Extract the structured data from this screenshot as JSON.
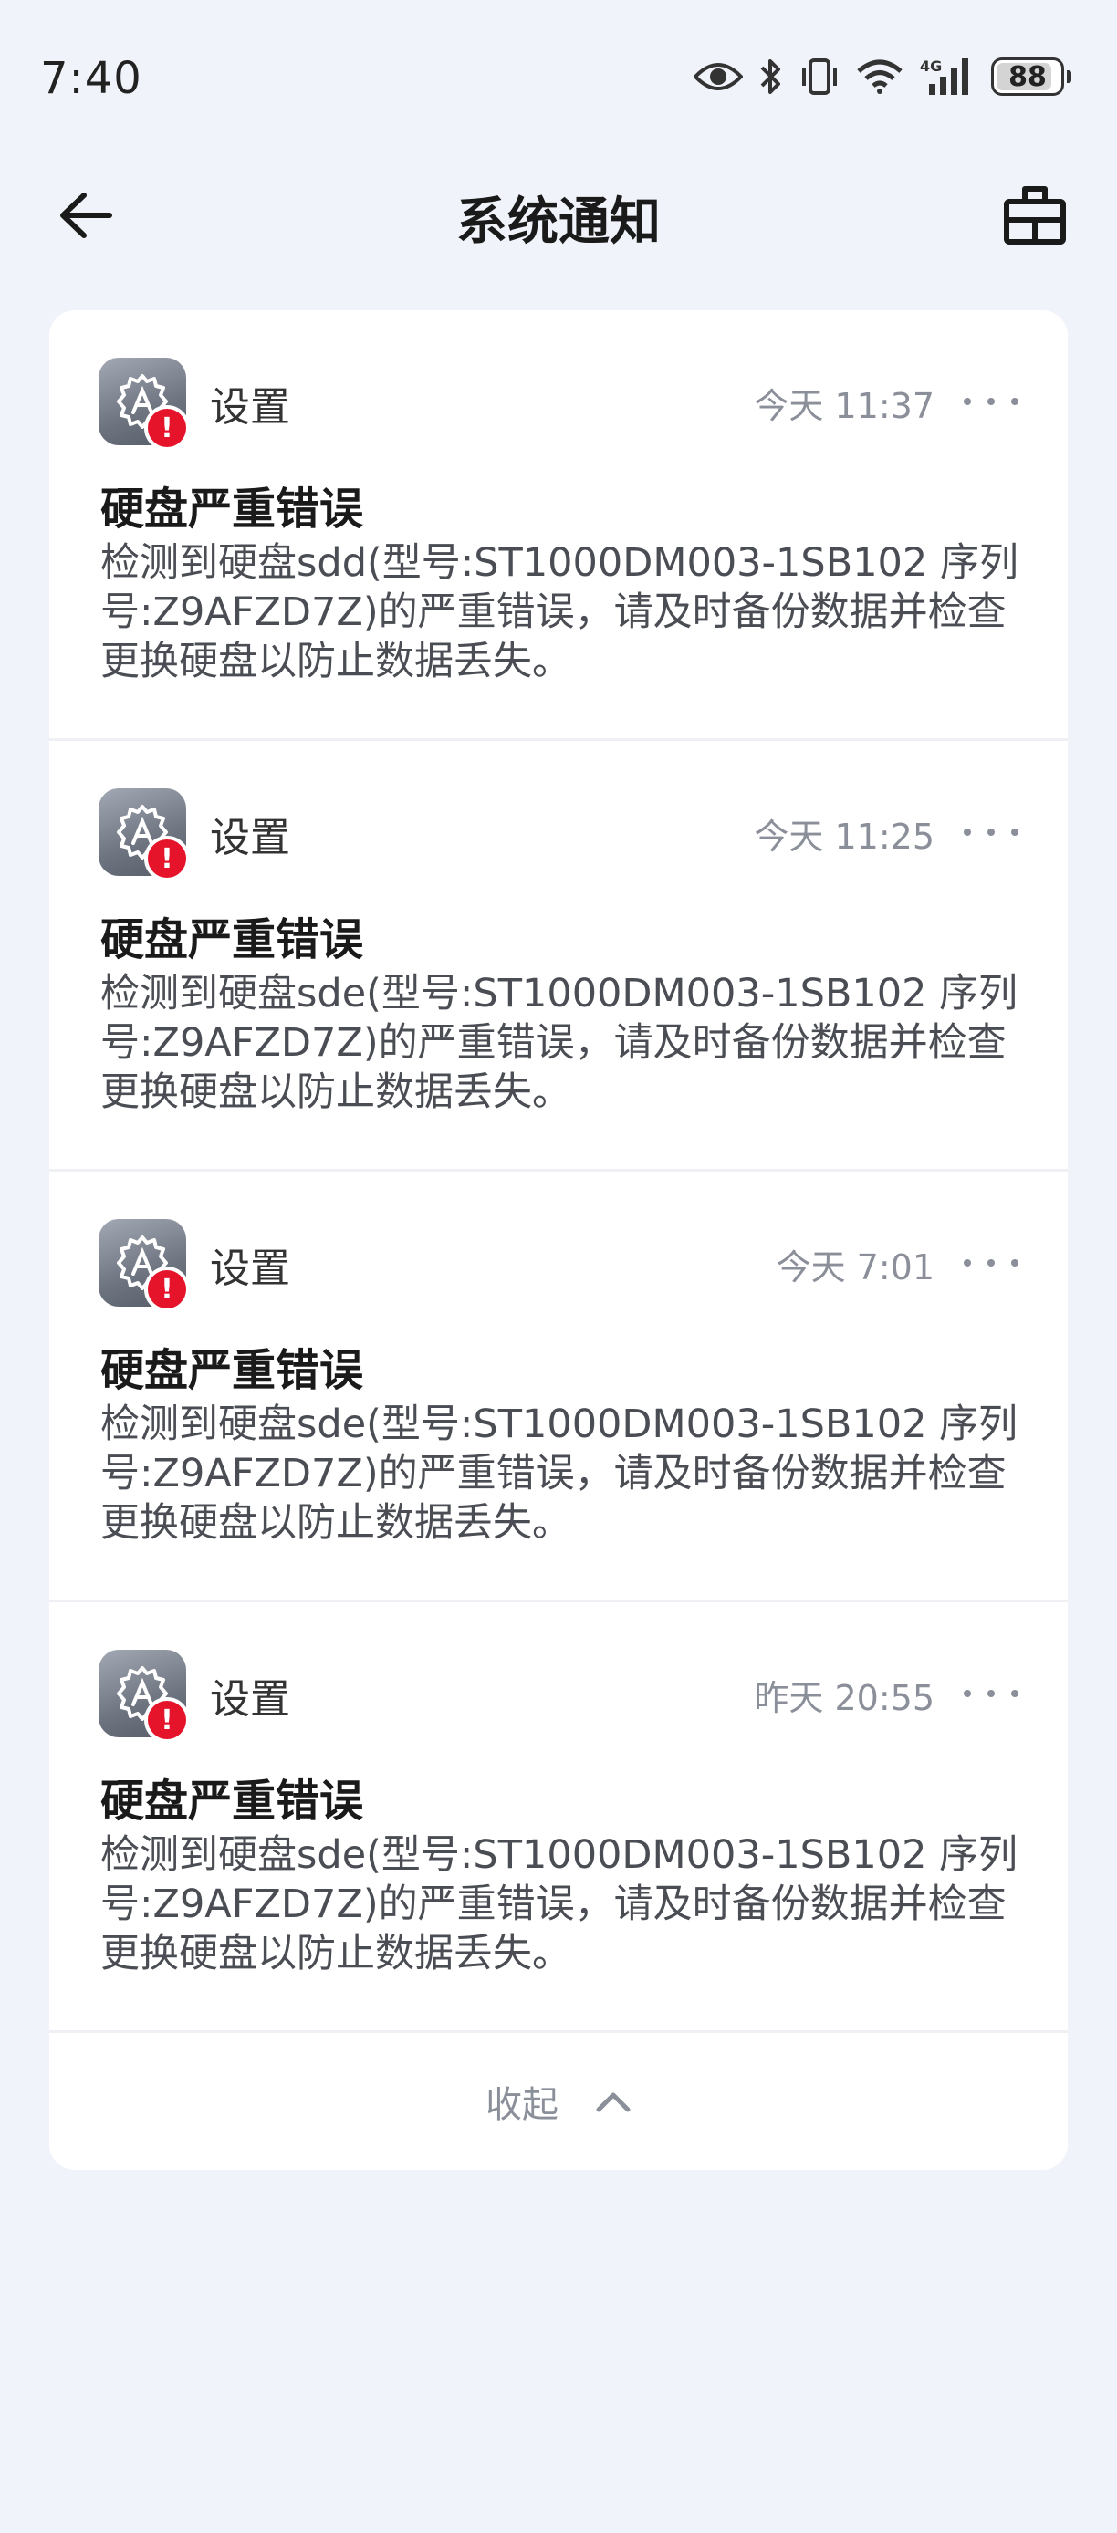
{
  "status_bar": {
    "time": "7:40",
    "network": "4G",
    "battery": "88",
    "battery_level": 0.88
  },
  "header": {
    "title": "系统通知",
    "back_icon": "arrow-left-icon",
    "clear_icon": "clear-all-icon"
  },
  "notifications": [
    {
      "app": "设置",
      "time": "今天 11:37",
      "title": "硬盘严重错误",
      "body": "检测到硬盘sdd(型号:ST1000DM003-1SB102 序列号:Z9AFZD7Z)的严重错误，请及时备份数据并检查更换硬盘以防止数据丢失。"
    },
    {
      "app": "设置",
      "time": "今天 11:25",
      "title": "硬盘严重错误",
      "body": "检测到硬盘sde(型号:ST1000DM003-1SB102 序列号:Z9AFZD7Z)的严重错误，请及时备份数据并检查更换硬盘以防止数据丢失。"
    },
    {
      "app": "设置",
      "time": "今天 7:01",
      "title": "硬盘严重错误",
      "body": "检测到硬盘sde(型号:ST1000DM003-1SB102 序列号:Z9AFZD7Z)的严重错误，请及时备份数据并检查更换硬盘以防止数据丢失。"
    },
    {
      "app": "设置",
      "time": "昨天 20:55",
      "title": "硬盘严重错误",
      "body": "检测到硬盘sde(型号:ST1000DM003-1SB102 序列号:Z9AFZD7Z)的严重错误，请及时备份数据并检查更换硬盘以防止数据丢失。"
    }
  ],
  "collapse": {
    "label": "收起"
  },
  "colors": {
    "background": "#f0f3f9",
    "card": "#ffffff",
    "alert": "#e5142b",
    "secondary_text": "#8a8f99"
  }
}
